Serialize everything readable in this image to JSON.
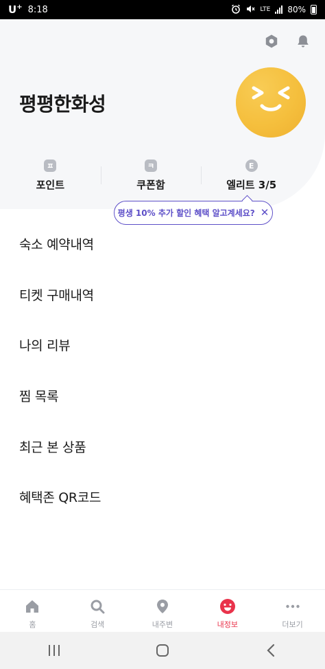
{
  "status_bar": {
    "carrier": "U",
    "carrier_plus": "+",
    "time": "8:18",
    "network": "LTE",
    "battery": "80%"
  },
  "header": {
    "settings_icon": "gear-icon",
    "notification_icon": "bell-icon"
  },
  "profile": {
    "name": "평평한화성",
    "avatar_color": "#f5bf3d"
  },
  "stats": [
    {
      "badge": "ㅍ",
      "label": "포인트"
    },
    {
      "badge": "ㅋ",
      "label": "쿠폰함"
    },
    {
      "badge": "E",
      "label": "엘리트 3/5"
    }
  ],
  "tooltip": {
    "text": "평생 10% 추가 할인 혜택 알고계세요?",
    "close": "✕",
    "color": "#5d4fc8"
  },
  "menu": {
    "items": [
      "숙소 예약내역",
      "티켓 구매내역",
      "나의 리뷰",
      "찜 목록",
      "최근 본 상품",
      "혜택존 QR코드"
    ]
  },
  "bottom_nav": {
    "items": [
      {
        "label": "홈",
        "icon": "home-icon"
      },
      {
        "label": "검색",
        "icon": "search-icon"
      },
      {
        "label": "내주변",
        "icon": "location-pin-icon"
      },
      {
        "label": "내정보",
        "icon": "smile-face-icon"
      },
      {
        "label": "더보기",
        "icon": "more-dots-icon"
      }
    ],
    "active_index": 3,
    "active_color": "#e9334b"
  }
}
